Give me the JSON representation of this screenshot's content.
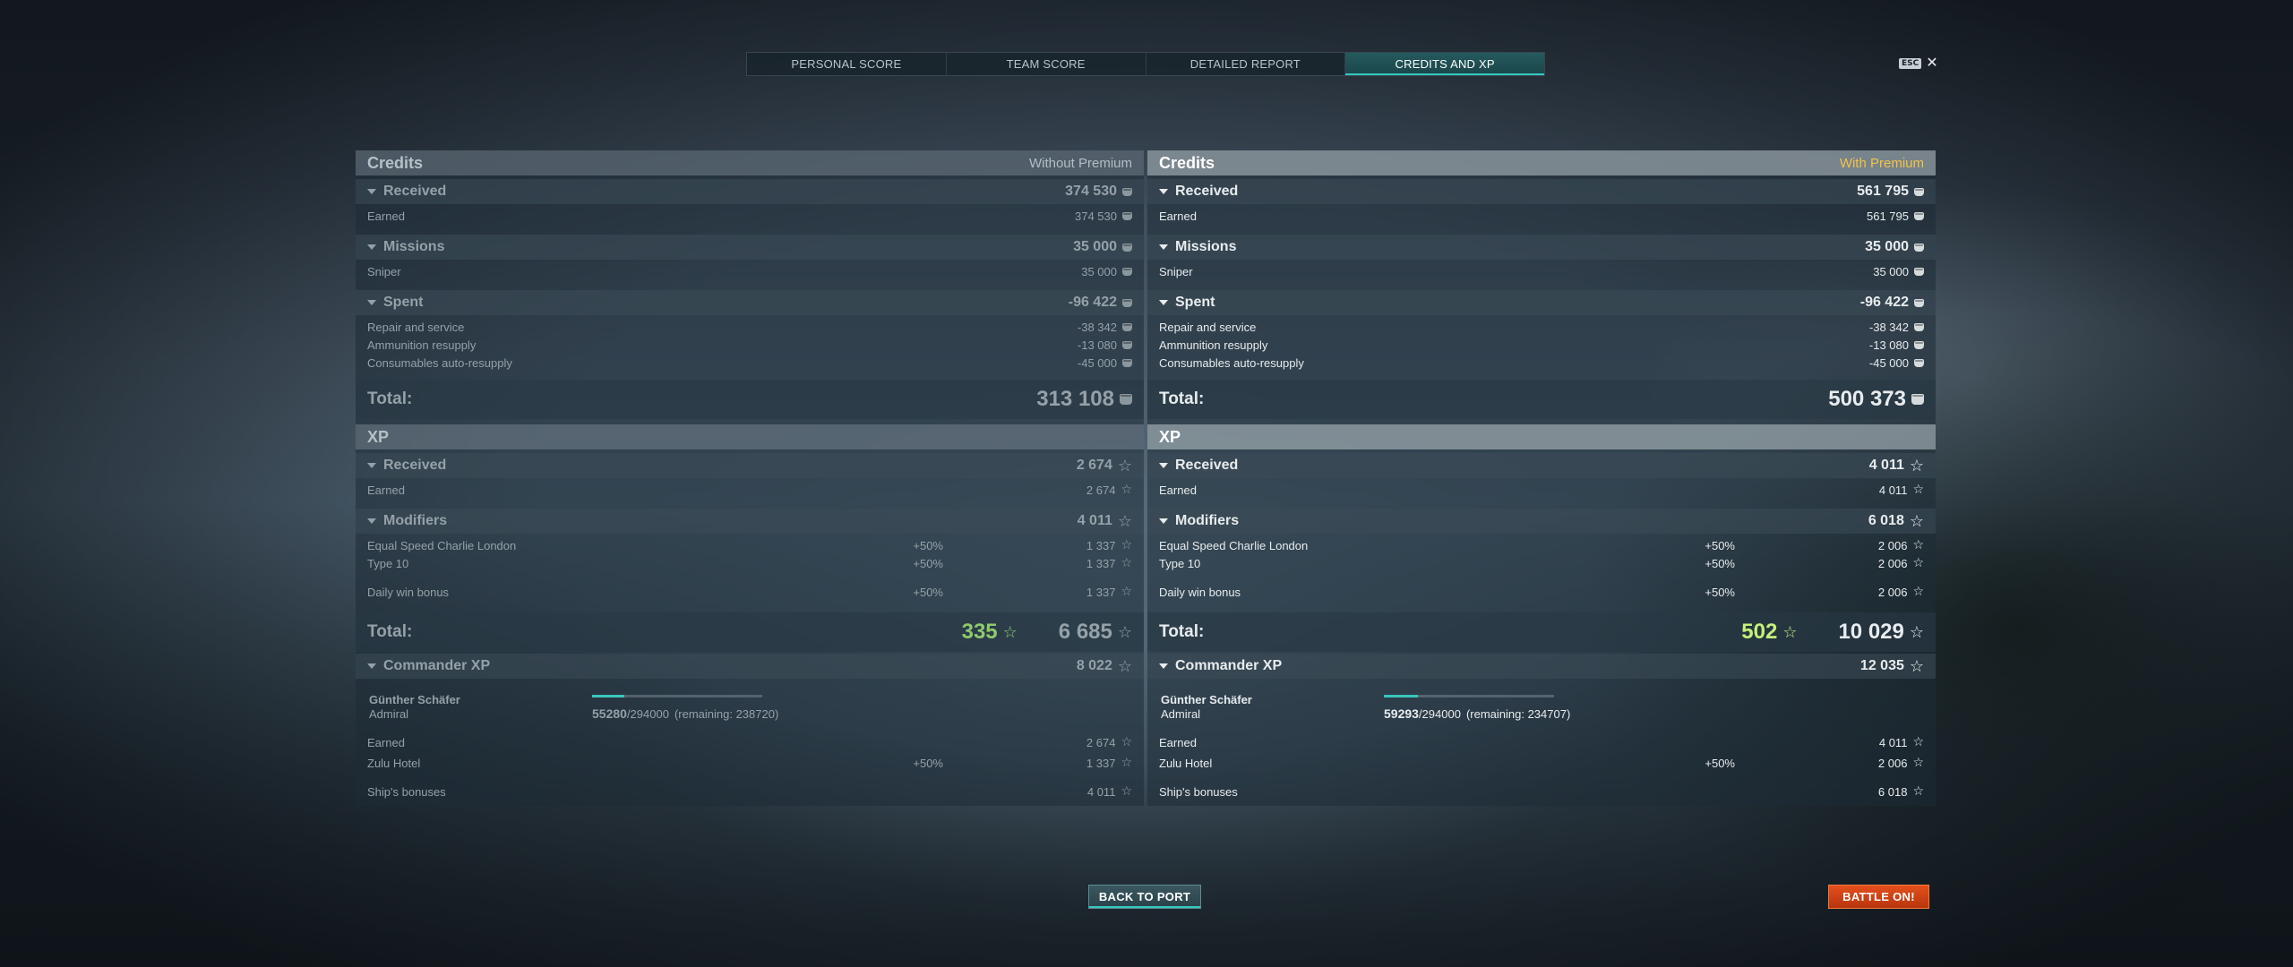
{
  "tabs": [
    {
      "label": "PERSONAL SCORE"
    },
    {
      "label": "TEAM SCORE"
    },
    {
      "label": "DETAILED REPORT"
    },
    {
      "label": "CREDITS AND XP"
    }
  ],
  "esc_label": "ESC",
  "left": {
    "credits_title": "Credits",
    "mode": "Without Premium",
    "received": {
      "label": "Received",
      "value": "374 530"
    },
    "earned": {
      "label": "Earned",
      "value": "374 530"
    },
    "missions": {
      "label": "Missions",
      "value": "35 000"
    },
    "sniper": {
      "label": "Sniper",
      "value": "35 000"
    },
    "spent": {
      "label": "Spent",
      "value": "-96 422"
    },
    "repair": {
      "label": "Repair and service",
      "value": "-38 342"
    },
    "ammo": {
      "label": "Ammunition resupply",
      "value": "-13 080"
    },
    "consumables": {
      "label": "Consumables auto-resupply",
      "value": "-45 000"
    },
    "credits_total": {
      "label": "Total:",
      "value": "313 108"
    },
    "xp_title": "XP",
    "xp_received": {
      "label": "Received",
      "value": "2 674"
    },
    "xp_earned": {
      "label": "Earned",
      "value": "2 674"
    },
    "modifiers": {
      "label": "Modifiers",
      "value": "4 011"
    },
    "mod1": {
      "label": "Equal Speed Charlie London",
      "pct": "+50%",
      "value": "1 337"
    },
    "mod2": {
      "label": "Type 10",
      "pct": "+50%",
      "value": "1 337"
    },
    "mod3": {
      "label": "Daily win bonus",
      "pct": "+50%",
      "value": "1 337"
    },
    "xp_total": {
      "label": "Total:",
      "free": "335",
      "value": "6 685"
    },
    "cmd": {
      "label": "Commander XP",
      "value": "8 022"
    },
    "cmd_name": "Günther Schäfer",
    "cmd_rank": "Admiral",
    "cmd_xp_cur": "55280",
    "cmd_xp_max": "/294000",
    "cmd_remaining": "(remaining: 238720)",
    "cmd_progress": 0.188,
    "cmd_earned": {
      "label": "Earned",
      "value": "2 674"
    },
    "cmd_zulu": {
      "label": "Zulu Hotel",
      "pct": "+50%",
      "value": "1 337"
    },
    "cmd_ship": {
      "label": "Ship's bonuses",
      "value": "4 011"
    }
  },
  "right": {
    "credits_title": "Credits",
    "mode": "With Premium",
    "received": {
      "label": "Received",
      "value": "561 795"
    },
    "earned": {
      "label": "Earned",
      "value": "561 795"
    },
    "missions": {
      "label": "Missions",
      "value": "35 000"
    },
    "sniper": {
      "label": "Sniper",
      "value": "35 000"
    },
    "spent": {
      "label": "Spent",
      "value": "-96 422"
    },
    "repair": {
      "label": "Repair and service",
      "value": "-38 342"
    },
    "ammo": {
      "label": "Ammunition resupply",
      "value": "-13 080"
    },
    "consumables": {
      "label": "Consumables auto-resupply",
      "value": "-45 000"
    },
    "credits_total": {
      "label": "Total:",
      "value": "500 373"
    },
    "xp_title": "XP",
    "xp_received": {
      "label": "Received",
      "value": "4 011"
    },
    "xp_earned": {
      "label": "Earned",
      "value": "4 011"
    },
    "modifiers": {
      "label": "Modifiers",
      "value": "6 018"
    },
    "mod1": {
      "label": "Equal Speed Charlie London",
      "pct": "+50%",
      "value": "2 006"
    },
    "mod2": {
      "label": "Type 10",
      "pct": "+50%",
      "value": "2 006"
    },
    "mod3": {
      "label": "Daily win bonus",
      "pct": "+50%",
      "value": "2 006"
    },
    "xp_total": {
      "label": "Total:",
      "free": "502",
      "value": "10 029"
    },
    "cmd": {
      "label": "Commander XP",
      "value": "12 035"
    },
    "cmd_name": "Günther Schäfer",
    "cmd_rank": "Admiral",
    "cmd_xp_cur": "59293",
    "cmd_xp_max": "/294000",
    "cmd_remaining": "(remaining: 234707)",
    "cmd_progress": 0.202,
    "cmd_earned": {
      "label": "Earned",
      "value": "4 011"
    },
    "cmd_zulu": {
      "label": "Zulu Hotel",
      "pct": "+50%",
      "value": "2 006"
    },
    "cmd_ship": {
      "label": "Ship's bonuses",
      "value": "6 018"
    }
  },
  "buttons": {
    "back": "BACK TO PORT",
    "battle": "BATTLE ON!"
  },
  "colors": {
    "accent": "#33c9c0",
    "premium": "#f2c34a",
    "battle": "#d9440f",
    "free_xp": "#8fc96e"
  },
  "icons": {
    "credits": "credit-coin-icon",
    "xp": "star-icon",
    "collapse": "triangle-down-icon",
    "close": "close-icon"
  }
}
